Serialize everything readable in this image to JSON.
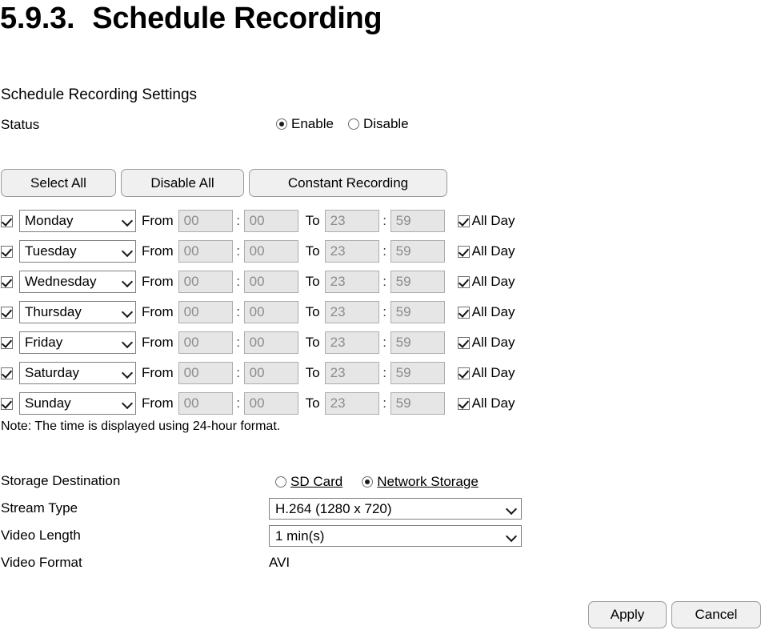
{
  "page": {
    "section_number": "5.9.3.",
    "title": "Schedule Recording",
    "section_title": "Schedule Recording Settings"
  },
  "status": {
    "label": "Status",
    "options": [
      {
        "label": "Enable",
        "selected": true
      },
      {
        "label": "Disable",
        "selected": false
      }
    ]
  },
  "actions": {
    "select_all": "Select All",
    "disable_all": "Disable All",
    "constant_recording": "Constant Recording"
  },
  "schedule": {
    "from_label": "From",
    "to_label": "To",
    "colon": ":",
    "all_day_label": "All Day",
    "rows": [
      {
        "day": "Monday",
        "enabled": true,
        "from_h": "00",
        "from_m": "00",
        "to_h": "23",
        "to_m": "59",
        "all_day": true
      },
      {
        "day": "Tuesday",
        "enabled": true,
        "from_h": "00",
        "from_m": "00",
        "to_h": "23",
        "to_m": "59",
        "all_day": true
      },
      {
        "day": "Wednesday",
        "enabled": true,
        "from_h": "00",
        "from_m": "00",
        "to_h": "23",
        "to_m": "59",
        "all_day": true
      },
      {
        "day": "Thursday",
        "enabled": true,
        "from_h": "00",
        "from_m": "00",
        "to_h": "23",
        "to_m": "59",
        "all_day": true
      },
      {
        "day": "Friday",
        "enabled": true,
        "from_h": "00",
        "from_m": "00",
        "to_h": "23",
        "to_m": "59",
        "all_day": true
      },
      {
        "day": "Saturday",
        "enabled": true,
        "from_h": "00",
        "from_m": "00",
        "to_h": "23",
        "to_m": "59",
        "all_day": true
      },
      {
        "day": "Sunday",
        "enabled": true,
        "from_h": "00",
        "from_m": "00",
        "to_h": "23",
        "to_m": "59",
        "all_day": true
      }
    ]
  },
  "note": "Note: The time is displayed using 24-hour format.",
  "storage": {
    "destination_label": "Storage Destination",
    "destination_options": [
      {
        "label": "SD Card",
        "selected": false
      },
      {
        "label": "Network Storage",
        "selected": true
      }
    ],
    "stream_type_label": "Stream Type",
    "stream_type_value": "H.264 (1280 x 720)",
    "video_length_label": "Video Length",
    "video_length_value": "1 min(s)",
    "video_format_label": "Video Format",
    "video_format_value": "AVI"
  },
  "footer": {
    "apply": "Apply",
    "cancel": "Cancel"
  }
}
